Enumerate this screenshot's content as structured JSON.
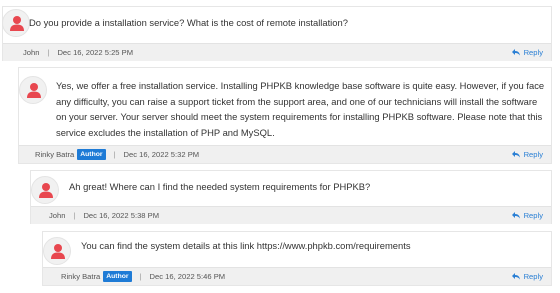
{
  "comments": [
    {
      "text": "Do you provide a installation service? What is the cost of remote installation?",
      "author": "John",
      "badge": "",
      "date": "Dec 16, 2022 5:25 PM",
      "reply_label": "Reply"
    },
    {
      "text": "Yes, we offer a free installation service. Installing PHPKB knowledge base software is quite easy. However, if you face any difficulty, you can raise a support ticket from the support area, and one of our technicians will install the software on your server. Your server should meet the system requirements for installing PHPKB software. Please note that this service excludes the installation of PHP and MySQL.",
      "author": "Rinky Batra",
      "badge": "Author",
      "date": "Dec 16, 2022 5:32 PM",
      "reply_label": "Reply"
    },
    {
      "text": "Ah great! Where can I find the needed system requirements for PHPKB?",
      "author": "John",
      "badge": "",
      "date": "Dec 16, 2022 5:38 PM",
      "reply_label": "Reply"
    },
    {
      "text": "You can find the system details at this link https://www.phpkb.com/requirements",
      "author": "Rinky Batra",
      "badge": "Author",
      "date": "Dec 16, 2022 5:46 PM",
      "reply_label": "Reply"
    }
  ],
  "icons": {
    "avatar": "user-icon",
    "reply": "reply-arrow-icon"
  },
  "colors": {
    "avatar_icon": "#e8474f",
    "badge": "#1e7bd6",
    "reply_link": "#2a7fd4",
    "meta_bar": "#f0f0f0"
  }
}
